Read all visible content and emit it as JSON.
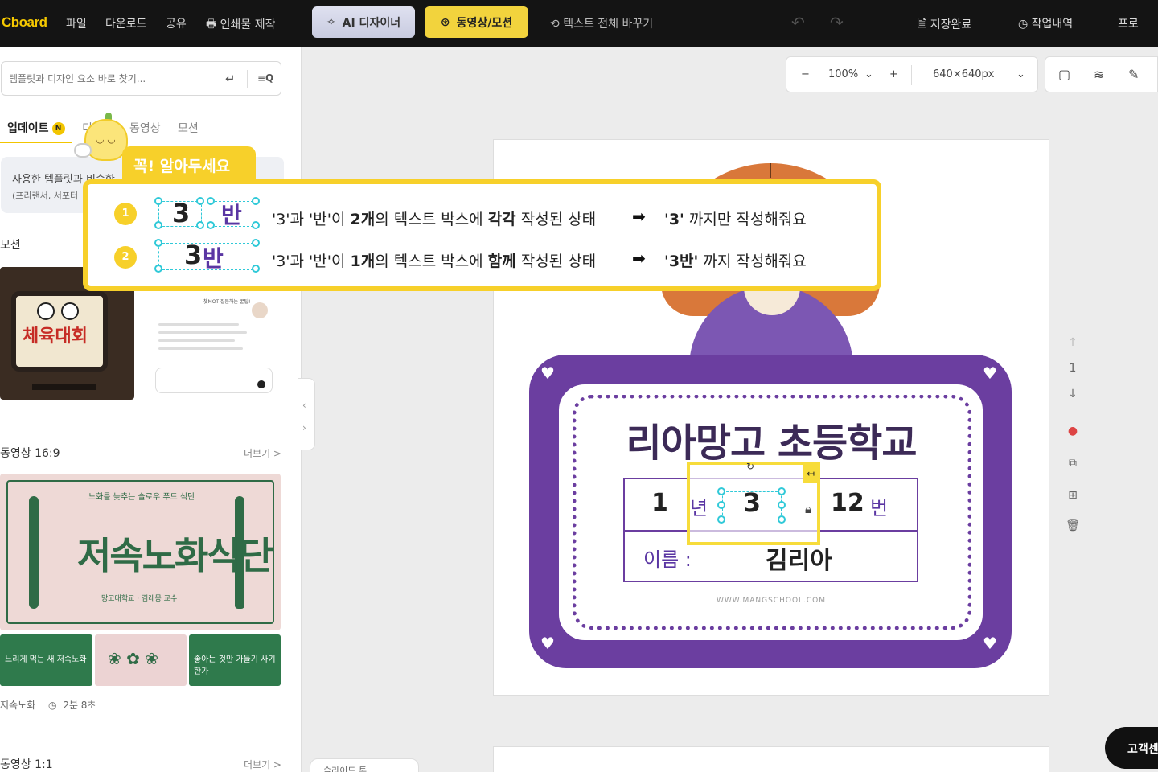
{
  "topbar": {
    "logo": "Cboard",
    "menu": [
      "파일",
      "다운로드",
      "공유",
      "인쇄물 제작"
    ],
    "ai_designer": "AI 디자이너",
    "video_motion": "동영상/모션",
    "replace_all_text": "텍스트 전체 바꾸기",
    "saved": "저장완료",
    "history": "작업내역",
    "pro": "프로"
  },
  "left_panel": {
    "search_placeholder": "템플릿과 디자인 요소 바로 찾기...",
    "tabs": [
      "업데이트",
      "디자인",
      "동영상",
      "모션"
    ],
    "tab_badge": "N",
    "notice_line1": "사용한 템플릿과 비슷한",
    "notice_line2": "(프리랜서, 서포터",
    "section_motion": "모션",
    "tv_title": "체육대회",
    "chat_header": "챗MOT 질문하는 꿀팁!",
    "section_video169": "동영상 16:9",
    "more": "더보기 >",
    "food_title": "저속노화식단",
    "food_top": "노화를 늦추는 슬로우 푸드 식단",
    "food_sub": "망고대학교 · 김레몽 교수",
    "mini1": "느리게 먹는 새 저속노화",
    "mini3": "좋아는 것만 가들기 사기 한가",
    "video_name": "저속노화",
    "video_duration": "2분 8초",
    "section_video11": "동영상 1:1"
  },
  "canvas": {
    "zoom": "100%",
    "size": "640×640px",
    "page_number": "1",
    "school_name": "리아망고 초등학교",
    "grade_num": "1",
    "grade_lbl": "년",
    "class_num": "3",
    "class_lbl": "반",
    "student_num": "12",
    "student_lbl": "번",
    "name_lbl": "이름 :",
    "name_val": "김리아",
    "url": "WWW.MANGSCHOOL.COM"
  },
  "tip": {
    "tab_title": "꼭! 알아두세요",
    "step1": "1",
    "step2": "2",
    "demo_3": "3",
    "demo_ban": "반",
    "demo_3ban_a": "3",
    "demo_3ban_b": "반",
    "rule1_a": "'3'과 '반'이 ",
    "rule1_b": "2개",
    "rule1_c": "의 텍스트 박스에 ",
    "rule1_d": "각각",
    "rule1_e": " 작성된 상태",
    "res1_a": "'3'",
    "res1_b": " 까지만 작성해줘요",
    "rule2_a": "'3'과 '반'이 ",
    "rule2_b": "1개",
    "rule2_c": "의 텍스트 박스에 ",
    "rule2_d": "함께",
    "rule2_e": " 작성된 상태",
    "res2_a": "'3반'",
    "res2_b": " 까지 작성해줘요"
  },
  "bottom": {
    "strip": "슬라이드 톤",
    "help": "고객센"
  },
  "colors": {
    "accent_yellow": "#f7d02a",
    "card_purple": "#6b3ea0",
    "selection_cyan": "#30c9d8",
    "topbar": "#141414"
  }
}
